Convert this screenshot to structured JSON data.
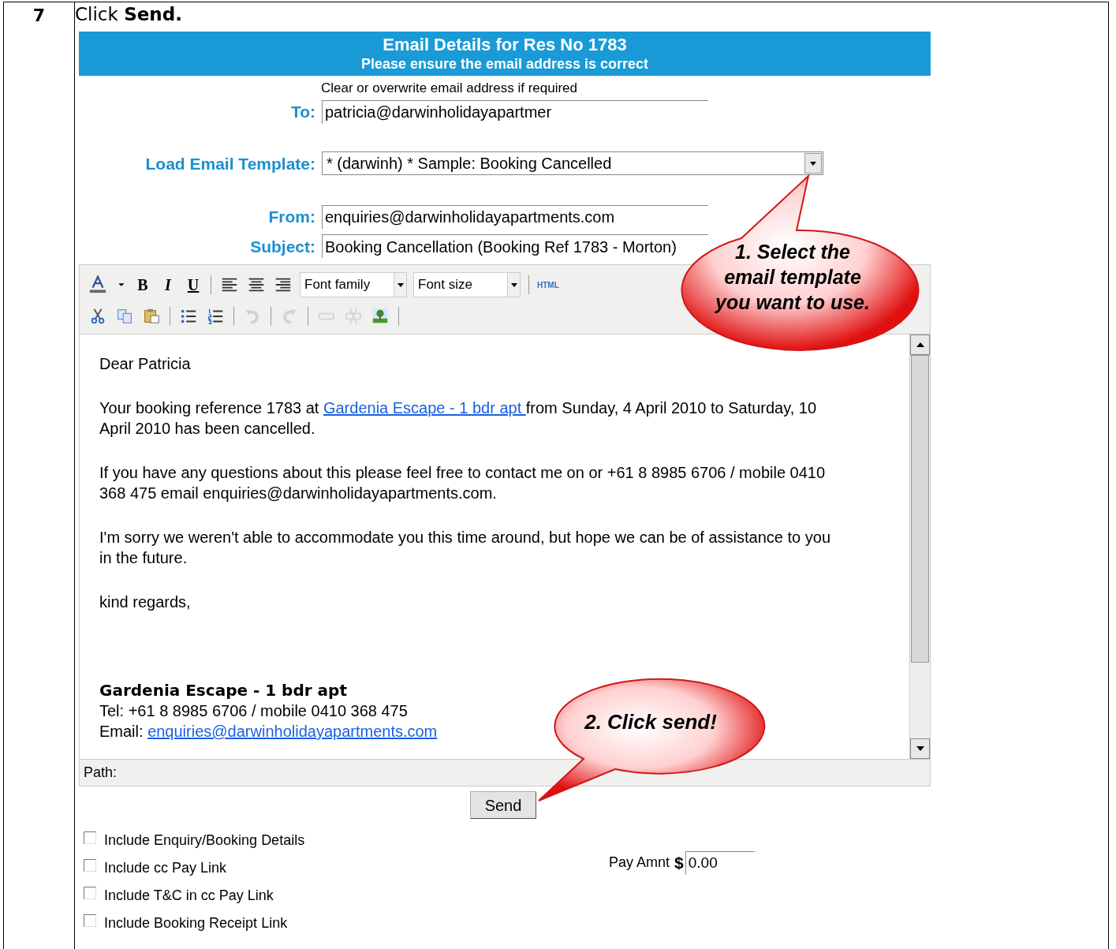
{
  "step": {
    "number": "7",
    "text": "Click **Send.**"
  },
  "header": {
    "title": "Email Details for Res No 1783",
    "subtitle": "Please ensure the email address is correct"
  },
  "hint": "Clear or overwrite email address if required",
  "fields": [
    {
      "kind": "input",
      "label": "To:",
      "value": "patricia@darwinholidayapartmer"
    },
    {
      "kind": "select",
      "label": "Load Email Template:",
      "value": "* (darwinh) * Sample: Booking Cancelled"
    },
    {
      "kind": "input",
      "label": "From:",
      "value": "enquiries@darwinholidayapartments.com"
    },
    {
      "kind": "input",
      "label": "Subject:",
      "value": "Booking Cancellation (Booking Ref 1783 - Morton)"
    }
  ],
  "toolbar_rows": [
    [
      {
        "kind": "font-color",
        "disabled": false
      },
      {
        "kind": "caret",
        "disabled": false
      },
      {
        "kind": "bold",
        "label": "B",
        "disabled": false
      },
      {
        "kind": "italic",
        "label": "I",
        "disabled": false
      },
      {
        "kind": "underline",
        "label": "U",
        "disabled": false
      },
      {
        "kind": "sep"
      },
      {
        "kind": "align-left",
        "disabled": false
      },
      {
        "kind": "align-center",
        "disabled": false
      },
      {
        "kind": "align-right",
        "disabled": false
      },
      {
        "kind": "select",
        "label": "Font family"
      },
      {
        "kind": "select",
        "label": "Font size"
      },
      {
        "kind": "sep"
      },
      {
        "kind": "html",
        "label": "HTML",
        "disabled": false
      }
    ],
    [
      {
        "kind": "cut",
        "disabled": false
      },
      {
        "kind": "copy",
        "disabled": false
      },
      {
        "kind": "paste",
        "disabled": false
      },
      {
        "kind": "sep"
      },
      {
        "kind": "bullets",
        "disabled": false
      },
      {
        "kind": "numbers",
        "disabled": false
      },
      {
        "kind": "sep"
      },
      {
        "kind": "undo",
        "disabled": true
      },
      {
        "kind": "sep"
      },
      {
        "kind": "redo",
        "disabled": true
      },
      {
        "kind": "sep"
      },
      {
        "kind": "link",
        "disabled": true
      },
      {
        "kind": "unlink",
        "disabled": true
      },
      {
        "kind": "image",
        "disabled": false
      },
      {
        "kind": "sep"
      }
    ]
  ],
  "body": [
    {
      "parts": [
        {
          "text": "Dear Patricia"
        }
      ]
    },
    {
      "parts": [
        {
          "text": "Your booking reference 1783 at "
        },
        {
          "text": "Gardenia Escape - 1 bdr apt ",
          "link": true
        },
        {
          "text": " from Sunday, 4 April 2010 to Saturday, 10 April 2010 has been cancelled."
        }
      ]
    },
    {
      "parts": [
        {
          "text": "If you have any questions about this please feel free to contact me on  or +61 8 8985 6706 / mobile 0410 368 475 email enquiries@darwinholidayapartments.com."
        }
      ]
    },
    {
      "parts": [
        {
          "text": "I'm sorry we weren't able to accommodate you this time around, but hope we can be of assistance to you in the future."
        }
      ]
    },
    {
      "parts": [
        {
          "text": "kind regards,"
        }
      ]
    }
  ],
  "signature": {
    "name": "Gardenia Escape - 1 bdr apt",
    "tel": "Tel: +61 8 8985 6706 / mobile 0410 368 475",
    "email_label": "Email: ",
    "email": "enquiries@darwinholidayapartments.com"
  },
  "path_label": "Path:",
  "send_button": "Send",
  "options": [
    {
      "label": "Include Enquiry/Booking Details",
      "checked": false
    },
    {
      "label": "Include cc Pay Link",
      "checked": false
    },
    {
      "label": "Include T&C in cc Pay Link",
      "checked": false
    },
    {
      "label": "Include Booking Receipt Link",
      "checked": false
    }
  ],
  "pay_amount": {
    "label": "Pay Amnt",
    "currency": "$",
    "value": "0.00"
  },
  "callouts": [
    {
      "text": "1. Select the email template you want to use."
    },
    {
      "text": "2. Click send!"
    }
  ]
}
